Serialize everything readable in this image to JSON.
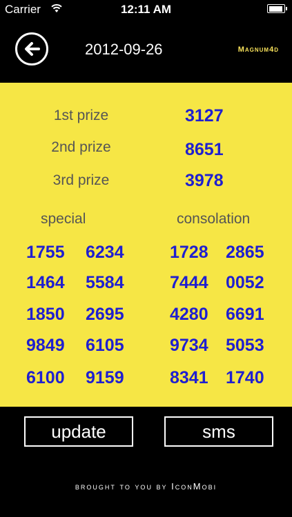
{
  "status_bar": {
    "carrier": "Carrier",
    "time": "12:11 AM"
  },
  "header": {
    "date": "2012-09-26",
    "brand": "Magnum4d"
  },
  "prizes": [
    {
      "label": "1st prize",
      "value": "3127"
    },
    {
      "label": "2nd prize",
      "value": "8651"
    },
    {
      "label": "3rd prize",
      "value": "3978"
    }
  ],
  "special": {
    "label": "special",
    "numbers": [
      "1755",
      "6234",
      "1464",
      "5584",
      "1850",
      "2695",
      "9849",
      "6105",
      "6100",
      "9159"
    ]
  },
  "consolation": {
    "label": "consolation",
    "numbers": [
      "1728",
      "2865",
      "7444",
      "0052",
      "4280",
      "6691",
      "9734",
      "5053",
      "8341",
      "1740"
    ]
  },
  "buttons": {
    "update": "update",
    "sms": "sms"
  },
  "footer": "brought to you by IconMobi",
  "colors": {
    "panel": "#f6e645",
    "number": "#1f1fd0",
    "brand": "#f6e05a"
  },
  "icons": {
    "back": "back-arrow-icon",
    "wifi": "wifi-icon",
    "battery": "battery-icon"
  }
}
